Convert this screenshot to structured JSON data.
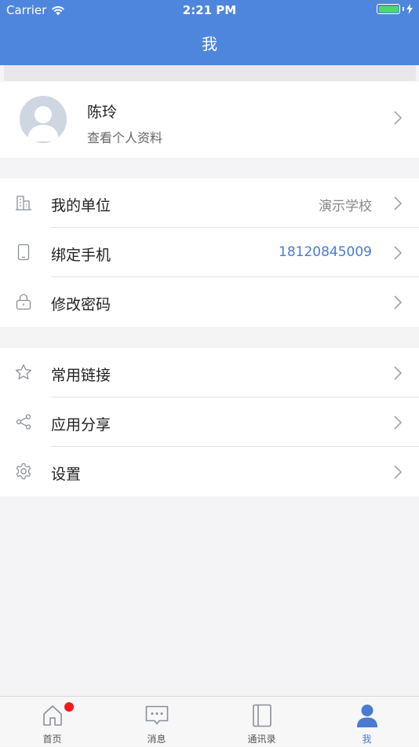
{
  "status_bar": {
    "carrier": "Carrier",
    "time": "2:21 PM"
  },
  "nav": {
    "title": "我"
  },
  "profile": {
    "name": "陈玲",
    "subtitle": "查看个人资料"
  },
  "group1": [
    {
      "label": "我的单位",
      "value": "演示学校",
      "value_color": "#888888",
      "icon": "building-icon"
    },
    {
      "label": "绑定手机",
      "value": "18120845009",
      "value_color": "#4a7bd0",
      "icon": "phone-icon"
    },
    {
      "label": "修改密码",
      "value": "",
      "icon": "lock-icon"
    }
  ],
  "group2": [
    {
      "label": "常用链接",
      "icon": "star-icon"
    },
    {
      "label": "应用分享",
      "icon": "share-icon"
    },
    {
      "label": "设置",
      "icon": "gear-icon"
    }
  ],
  "tabs": [
    {
      "label": "首页",
      "icon": "home-icon",
      "badge": true
    },
    {
      "label": "消息",
      "icon": "message-icon"
    },
    {
      "label": "通讯录",
      "icon": "contacts-icon"
    },
    {
      "label": "我",
      "icon": "person-icon",
      "active": true
    }
  ],
  "colors": {
    "brand": "#4f86dd",
    "accent": "#4a7bd0",
    "badge": "#f5191c"
  }
}
